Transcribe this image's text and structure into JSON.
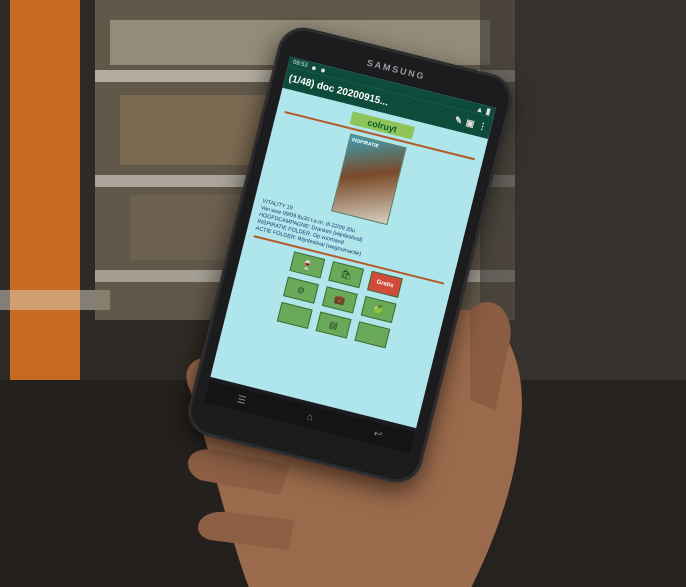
{
  "scene": {
    "phone_brand": "SAMSUNG"
  },
  "status_bar": {
    "time": "09:53"
  },
  "app_bar": {
    "title": "(1/48) doc 20200915..."
  },
  "document": {
    "logo_text": "colruyt",
    "folder_label": "INSPIRATIE",
    "info_lines": [
      "VITALITY 19",
      "Van woe 09/09 8u30 t.e.m. di 22/09 20u",
      "HOOFDCAMPAGNE: Dranken (wijnfestival)",
      "INSPIRATIE FOLDER: Op voorhand",
      "ACTIE FOLDER: Wijnfestival (wegnumactie)"
    ],
    "tile_gratis": "Gratis"
  },
  "colors": {
    "app_bar": "#0d4c3a",
    "screen_bg": "#aee6ec",
    "logo_green": "#8fc45a",
    "rule_brown": "#b35a2a",
    "tile_green": "#6aa85a",
    "tile_red": "#d24a3a"
  },
  "icons": [
    "pin-icon",
    "doc-icon",
    "more-vert-icon",
    "back-icon",
    "home-icon",
    "recents-icon"
  ]
}
